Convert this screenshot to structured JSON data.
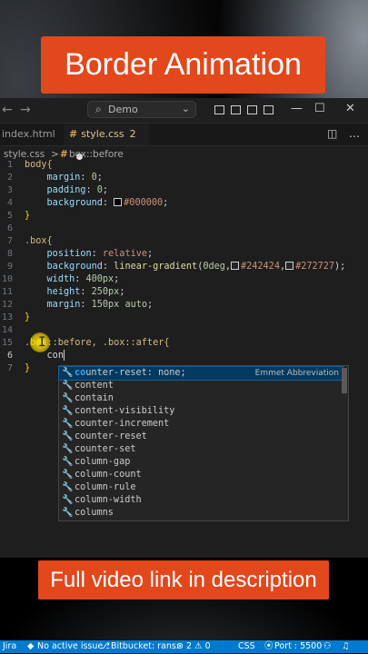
{
  "banner_top": "Border Animation",
  "banner_bottom": "Full video link in description",
  "titlebar": {
    "search_text": "Demo",
    "win_min": "—",
    "win_max": "☐",
    "win_close": "✕"
  },
  "tabs": [
    {
      "label": "index.html"
    },
    {
      "label": "style.css",
      "badge": "2"
    }
  ],
  "breadcrumbs": {
    "file": "style.css",
    "sep": ">",
    "symbol": "box::before"
  },
  "line_numbers": [
    "1",
    "2",
    "3",
    "4",
    "5",
    "6",
    "7",
    "8",
    "9",
    "10",
    "11",
    "12",
    "13",
    "14",
    "15",
    "6",
    "7"
  ],
  "code": {
    "l1": "body{",
    "l2_prop": "margin",
    "l2_val": "0",
    "l3_prop": "padding",
    "l3_val": "0",
    "l4_prop": "background",
    "l4_val": "#000000",
    "l5": "}",
    "l7": ".box{",
    "l8_prop": "position",
    "l8_val": "relative",
    "l9_prop": "background",
    "l9_fn": "linear-gradient",
    "l9_deg": "0deg",
    "l9_c1": "#242424",
    "l9_c2": "#272727",
    "l10_prop": "width",
    "l10_val": "400px",
    "l11_prop": "height",
    "l11_val": "250px",
    "l12_prop": "margin",
    "l12_val": "150px auto",
    "l13": "}",
    "l15": ".box::before, .box::after{",
    "l16": "con",
    "l17": "}"
  },
  "suggestions": [
    {
      "prefix": "co",
      "mid": "u",
      "rest": "nter-reset: none;",
      "detail": "Emmet Abbreviation"
    },
    {
      "label": "content"
    },
    {
      "label": "contain"
    },
    {
      "label": "content-visibility"
    },
    {
      "label": "counter-increment"
    },
    {
      "label": "counter-reset"
    },
    {
      "label": "counter-set"
    },
    {
      "label": "column-gap"
    },
    {
      "label": "column-count"
    },
    {
      "label": "column-rule"
    },
    {
      "label": "column-width"
    },
    {
      "label": "columns"
    }
  ],
  "statusbar": {
    "jira": "Jira",
    "issue": "No active issue",
    "bitbucket": "Bitbucket: rans:",
    "errors": "⊗ 2 ⚠ 0",
    "lang": "CSS",
    "port": "Port : 5500"
  },
  "colors": {
    "accent": "#e2481c",
    "status": "#007acc"
  }
}
